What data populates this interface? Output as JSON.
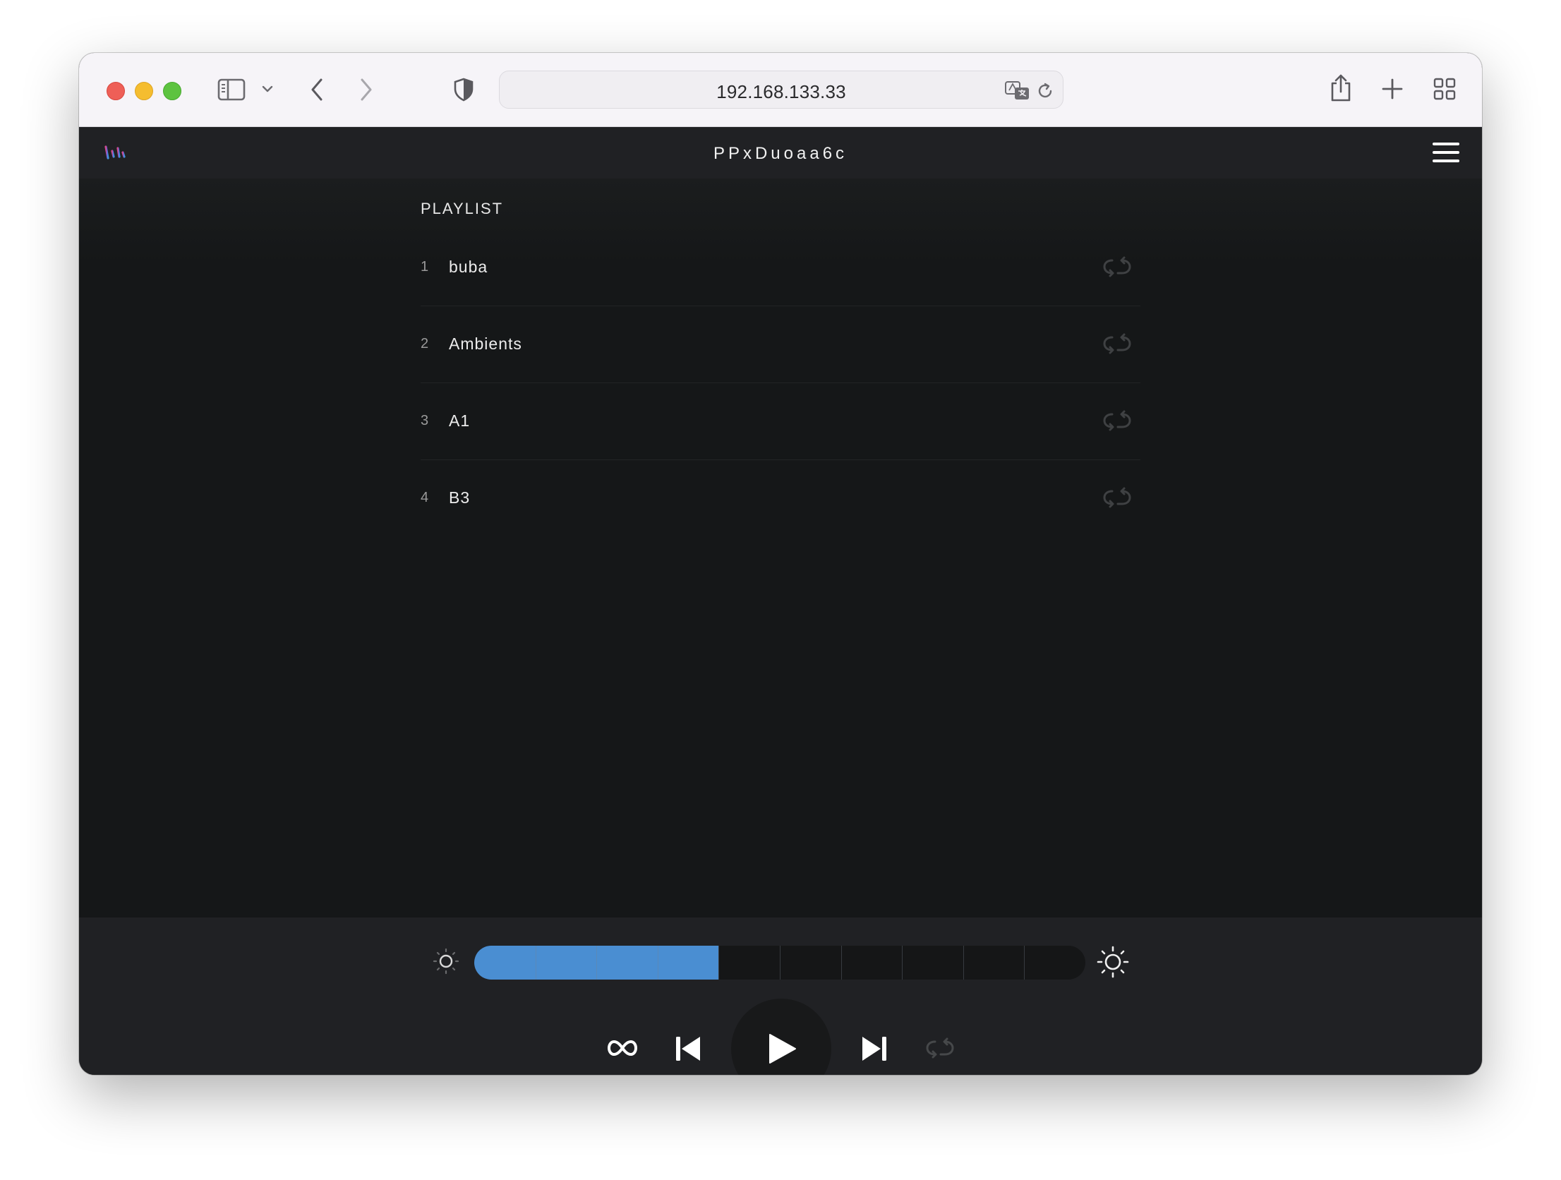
{
  "browser": {
    "url": "192.168.133.33"
  },
  "app": {
    "title": "PPxDuoaa6c"
  },
  "playlist": {
    "heading": "PLAYLIST",
    "items": [
      {
        "number": "1",
        "name": "buba"
      },
      {
        "number": "2",
        "name": "Ambients"
      },
      {
        "number": "3",
        "name": "A1"
      },
      {
        "number": "4",
        "name": "B3"
      }
    ]
  },
  "player": {
    "brightness": {
      "level": 4,
      "segments": 10
    },
    "controls": [
      "infinite-loop-icon",
      "skip-previous-icon",
      "play-icon",
      "skip-next-icon",
      "repeat-icon"
    ]
  },
  "colors": {
    "accent": "#4a8ed2",
    "background": "#151718",
    "header": "#202124",
    "logo_gradient": [
      "#d84a8a",
      "#7a5ad8",
      "#3a9ae0"
    ]
  }
}
